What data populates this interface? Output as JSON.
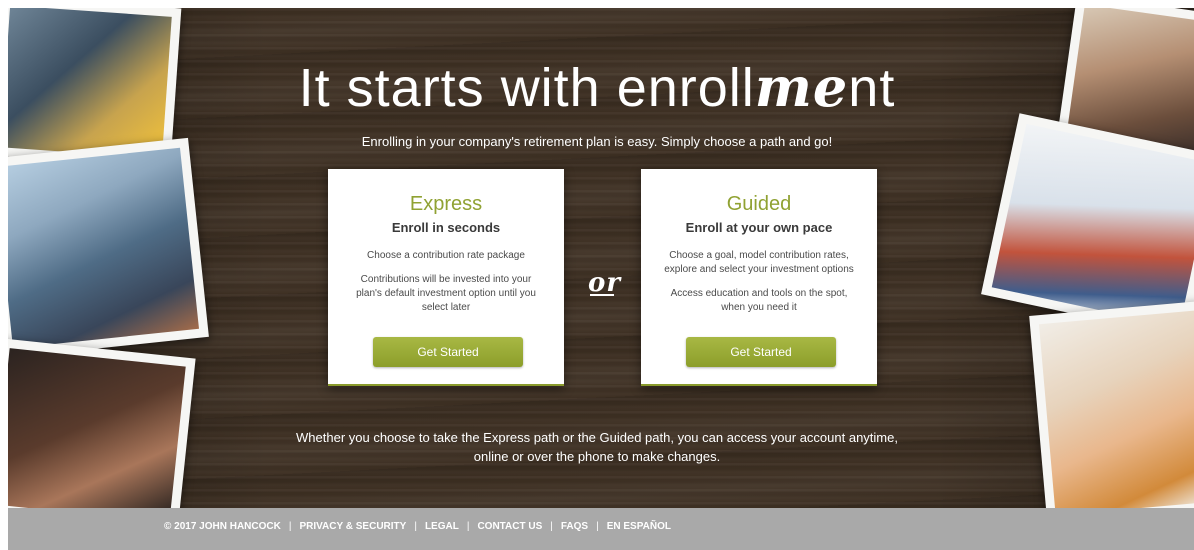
{
  "hero": {
    "headline_prefix": "It starts with enroll",
    "headline_me": "me",
    "headline_suffix": "nt",
    "subtitle": "Enrolling in your company's retirement plan is easy. Simply choose a path and go!",
    "or_label": "or",
    "bottom_text_line1": "Whether you choose to take the Express path or the Guided path, you can access your account anytime,",
    "bottom_text_line2": "online or over the phone to make changes."
  },
  "express": {
    "title": "Express",
    "subtitle": "Enroll in seconds",
    "desc1": "Choose a contribution rate package",
    "desc2": "Contributions will be invested into your plan's default investment option until you select later",
    "button": "Get Started"
  },
  "guided": {
    "title": "Guided",
    "subtitle": "Enroll at your own pace",
    "desc1": "Choose a goal, model contribution rates, explore and select your investment options",
    "desc2": "Access education and tools on the spot, when you need it",
    "button": "Get Started"
  },
  "footer": {
    "copyright": "© 2017 JOHN HANCOCK",
    "privacy": "PRIVACY & SECURITY",
    "legal": "LEGAL",
    "contact": "CONTACT US",
    "faqs": "FAQS",
    "espanol": "EN ESPAÑOL",
    "separator": "|"
  },
  "colors": {
    "accent_green": "#90a233",
    "button_green": "#9aab38",
    "footer_gray": "#a9a9a9",
    "wood_brown": "#3e3023"
  }
}
